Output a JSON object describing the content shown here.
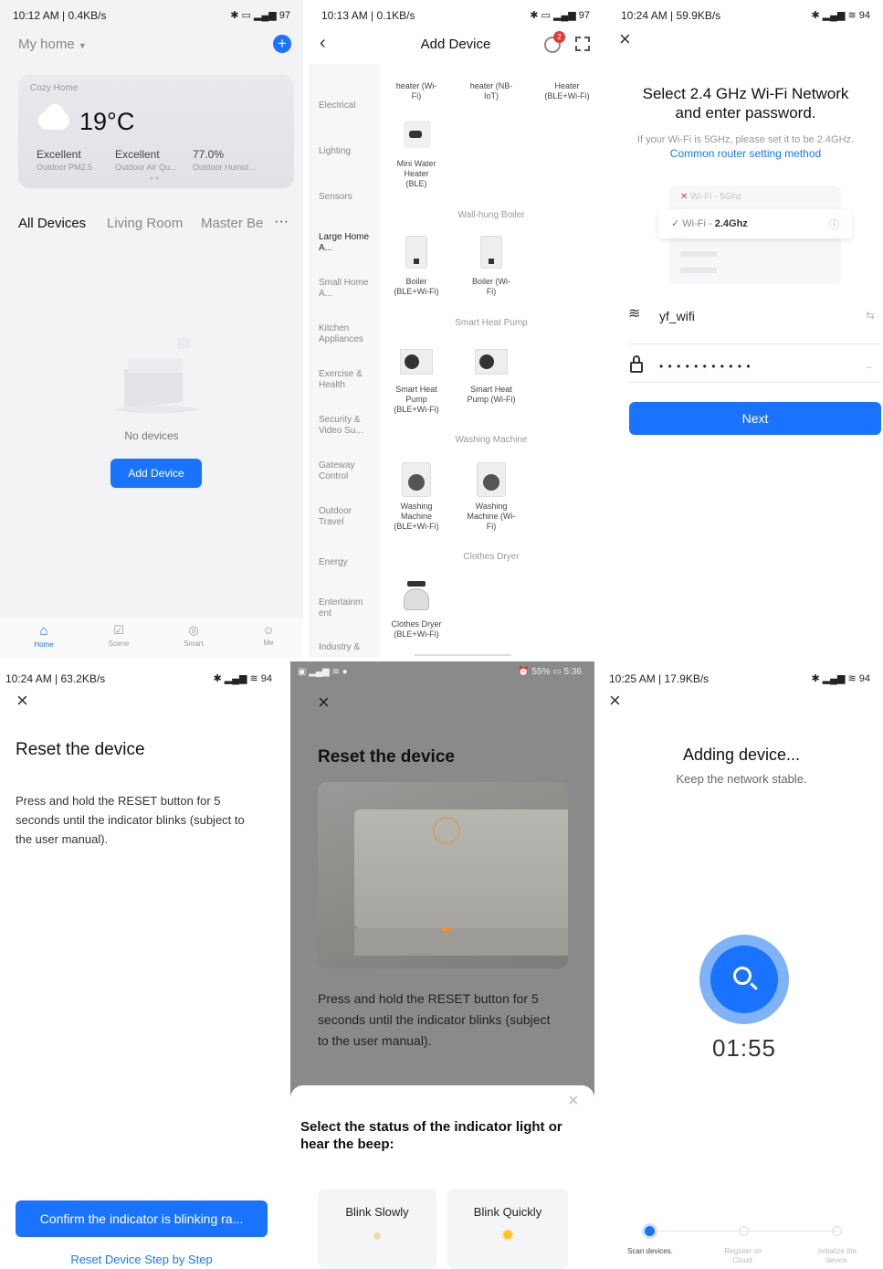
{
  "p1": {
    "status_time": "10:12 AM | 0.4KB/s",
    "status_right": "✱ ▭ ▂▄▆ 97",
    "home_selector": "My home",
    "weather": {
      "home_name": "Cozy Home",
      "temp": "19°C",
      "stats": [
        {
          "value": "Excellent",
          "label": "Outdoor PM2.5"
        },
        {
          "value": "Excellent",
          "label": "Outdoor Air Qu..."
        },
        {
          "value": "77.0%",
          "label": "Outdoor Humid..."
        }
      ]
    },
    "tabs": [
      "All Devices",
      "Living Room",
      "Master Be"
    ],
    "more": "···",
    "empty_text": "No devices",
    "add_button": "Add Device",
    "nav": [
      "Home",
      "Scene",
      "Smart",
      "Me"
    ]
  },
  "p2": {
    "status_time": "10:13 AM | 0.1KB/s",
    "status_right": "✱ ▭ ▂▄▆ 97",
    "title": "Add Device",
    "badge": "2",
    "categories": [
      "Electrical",
      "Lighting",
      "Sensors",
      "Large Home A...",
      "Small Home A...",
      "Kitchen Appliances",
      "Exercise & Health",
      "Security & Video Su...",
      "Gateway Control",
      "Outdoor Travel",
      "Energy",
      "Entertainm ent",
      "Industry &"
    ],
    "top_items": [
      "heater (Wi-Fi)",
      "heater (NB-IoT)",
      "Heater (BLE+Wi-Fi)"
    ],
    "mini_water": "Mini Water Heater (BLE)",
    "sections": {
      "boiler": "Wall-hung Boiler",
      "pump": "Smart Heat Pump",
      "washer": "Washing Machine",
      "dryer": "Clothes Dryer"
    },
    "boiler_items": [
      "Boiler (BLE+Wi-Fi)",
      "Boiler (Wi-Fi)"
    ],
    "pump_items": [
      "Smart Heat Pump (BLE+Wi-Fi)",
      "Smart Heat Pump (Wi-Fi)"
    ],
    "washer_items": [
      "Washing Machine (BLE+Wi-Fi)",
      "Washing Machine (Wi-Fi)"
    ],
    "dryer_items": [
      "Clothes Dryer (BLE+Wi-Fi)"
    ]
  },
  "p3": {
    "status_time": "10:24 AM | 59.9KB/s",
    "status_right": "✱ ▂▄▆ ≋ 94",
    "heading_line1": "Select 2.4 GHz Wi-Fi Network",
    "heading_line2": "and enter password.",
    "hint": "If your Wi-Fi is 5GHz, please set it to be 2.4GHz.",
    "link": "Common router setting method",
    "wifi_5g_prefix": "Wi-Fi - ",
    "wifi_5g": "5Ghz",
    "wifi_24_prefix": "Wi-Fi - ",
    "wifi_24": "2.4Ghz",
    "ssid": "yf_wifi",
    "password_mask": "• • • • • • • • • • •",
    "next_button": "Next"
  },
  "p4": {
    "status_time": "10:24 AM | 63.2KB/s",
    "status_right": "✱ ▂▄▆ ≋ 94",
    "title": "Reset the device",
    "body": "Press and hold the RESET button for 5 seconds until the indicator blinks (subject to the user manual).",
    "confirm_button": "Confirm the indicator is blinking ra...",
    "step_link": "Reset Device Step by Step"
  },
  "p5": {
    "status_left": "▣ ▂▄▆ ≋ ●",
    "status_right": "⏰ 55% ▭ 5:36",
    "title": "Reset the device",
    "body": "Press and hold the RESET button for 5 seconds until the indicator blinks (subject to the user manual).",
    "sheet_title": "Select the status of the indicator light or hear the beep:",
    "options": [
      "Blink Slowly",
      "Blink Quickly"
    ]
  },
  "p6": {
    "status_time": "10:25 AM | 17.9KB/s",
    "status_right": "✱ ▂▄▆ ≋ 94",
    "title": "Adding device...",
    "subtitle": "Keep the network stable.",
    "timer": "01:55",
    "steps": [
      "Scan devices.",
      "Register on Cloud.",
      "Initialize the device."
    ]
  },
  "colors": {
    "accent": "#1a73ff",
    "badge": "#e53935"
  }
}
